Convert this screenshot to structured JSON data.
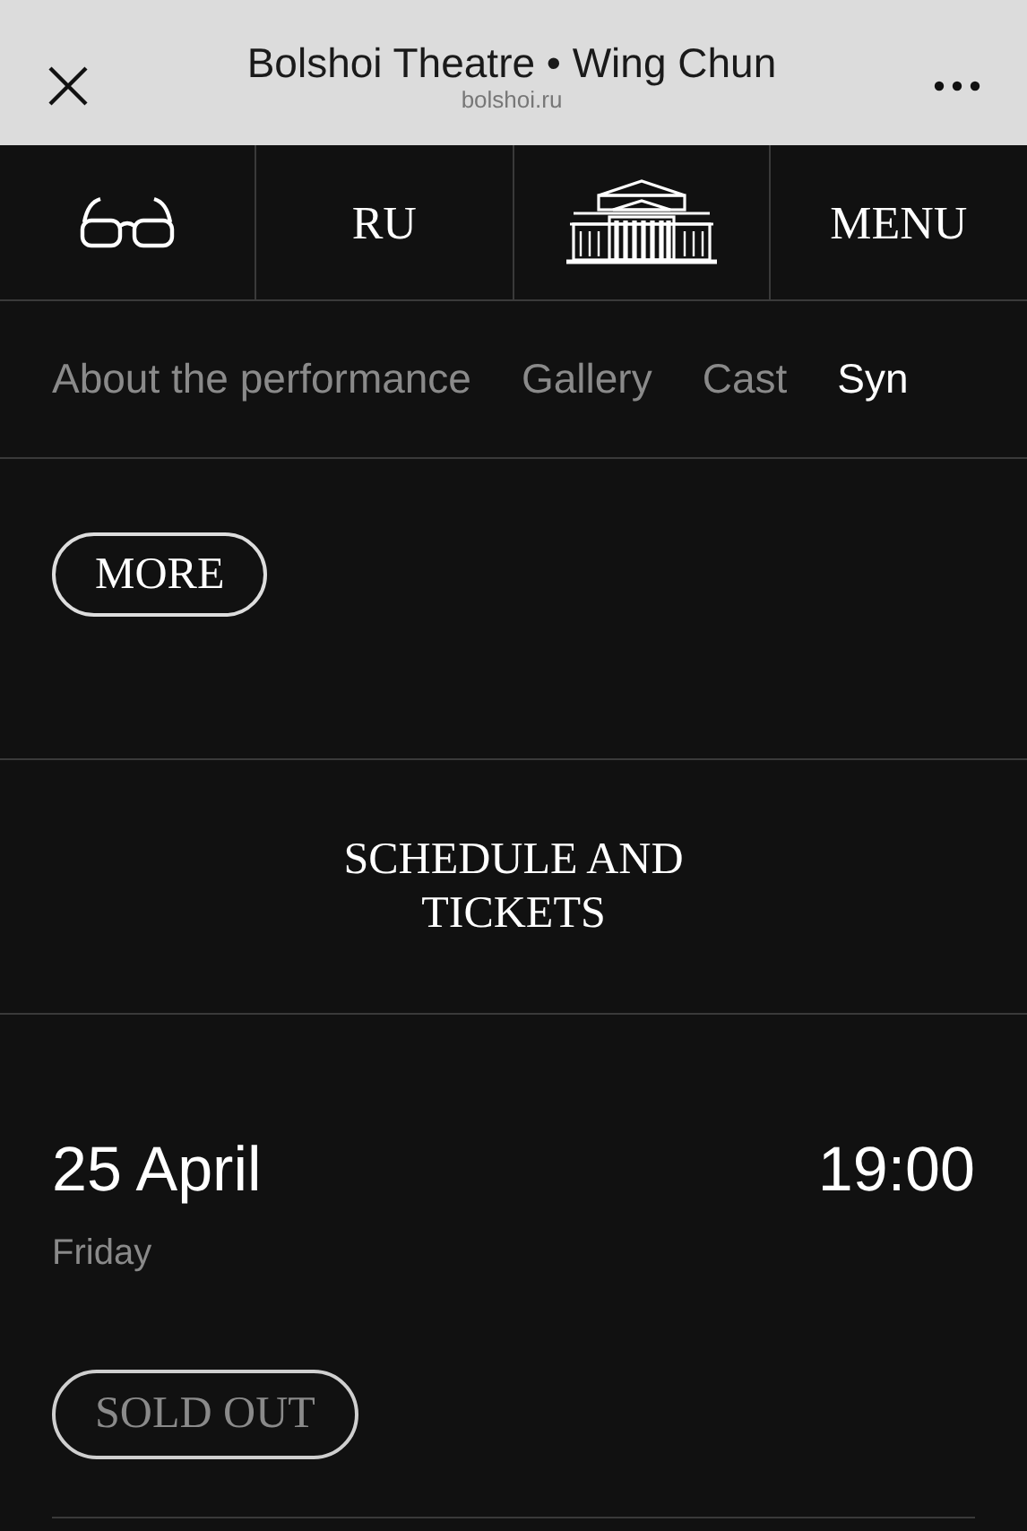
{
  "browser_bar": {
    "title": "Bolshoi Theatre • Wing Chun",
    "url": "bolshoi.ru"
  },
  "nav": {
    "language": "RU",
    "menu": "MENU"
  },
  "tabs": [
    {
      "label": "About the performance",
      "selected": false
    },
    {
      "label": "Gallery",
      "selected": false
    },
    {
      "label": "Cast",
      "selected": false
    },
    {
      "label": "Syn",
      "selected": true
    }
  ],
  "more_button": "MORE",
  "schedule": {
    "heading": "SCHEDULE AND TICKETS",
    "events": [
      {
        "date": "25 April",
        "weekday": "Friday",
        "time": "19:00",
        "button": "SOLD OUT",
        "disabled": true
      }
    ]
  }
}
